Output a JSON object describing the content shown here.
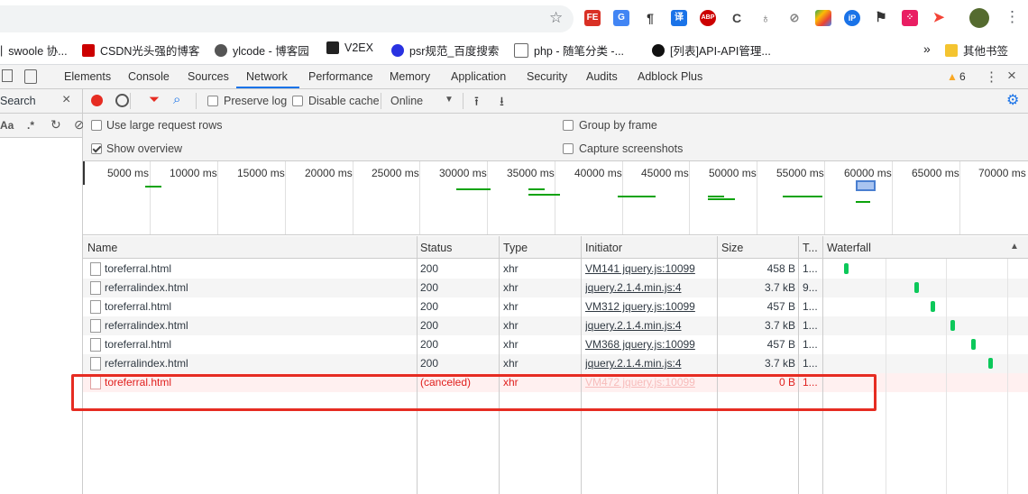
{
  "bookmarks": [
    {
      "label": "swoole 协...",
      "prefix": "|"
    },
    {
      "label": "CSDN光头强的博客"
    },
    {
      "label": "ylcode - 博客园"
    },
    {
      "label": "V2EX"
    },
    {
      "label": "psr规范_百度搜索"
    },
    {
      "label": "php - 随笔分类 -..."
    },
    {
      "label": "[列表]API-API管理..."
    },
    {
      "label": "»"
    },
    {
      "label": "其他书签"
    }
  ],
  "extensions": {
    "fe": "FE",
    "yi": "译",
    "abp": "ABP",
    "ip": "iP",
    "ci": "C"
  },
  "devtools": {
    "tabs": [
      "Elements",
      "Console",
      "Sources",
      "Network",
      "Performance",
      "Memory",
      "Application",
      "Security",
      "Audits",
      "Adblock Plus"
    ],
    "active_tab": "Network",
    "warning_count": "6",
    "close": "×",
    "more": "⋮"
  },
  "search": {
    "title": "Search",
    "close": "×",
    "aa": "Aa",
    "regex": ".*"
  },
  "network_toolbar": {
    "preserve_log": "Preserve log",
    "disable_cache": "Disable cache",
    "throttle": "Online"
  },
  "settings": {
    "large_rows": "Use large request rows",
    "show_overview": "Show overview",
    "group_by_frame": "Group by frame",
    "capture_screenshots": "Capture screenshots"
  },
  "overview": {
    "ticks": [
      "5000 ms",
      "10000 ms",
      "15000 ms",
      "20000 ms",
      "25000 ms",
      "30000 ms",
      "35000 ms",
      "40000 ms",
      "45000 ms",
      "50000 ms",
      "55000 ms",
      "60000 ms",
      "65000 ms",
      "70000 ms"
    ]
  },
  "columns": {
    "name": "Name",
    "status": "Status",
    "type": "Type",
    "initiator": "Initiator",
    "size": "Size",
    "time": "T...",
    "waterfall": "Waterfall"
  },
  "rows": [
    {
      "name": "toreferral.html",
      "status": "200",
      "type": "xhr",
      "initiator": "VM141 jquery.js:10099",
      "size": "458 B",
      "time": "1..."
    },
    {
      "name": "referralindex.html",
      "status": "200",
      "type": "xhr",
      "initiator": "jquery.2.1.4.min.js:4",
      "size": "3.7 kB",
      "time": "9..."
    },
    {
      "name": "toreferral.html",
      "status": "200",
      "type": "xhr",
      "initiator": "VM312 jquery.js:10099",
      "size": "457 B",
      "time": "1..."
    },
    {
      "name": "referralindex.html",
      "status": "200",
      "type": "xhr",
      "initiator": "jquery.2.1.4.min.js:4",
      "size": "3.7 kB",
      "time": "1..."
    },
    {
      "name": "toreferral.html",
      "status": "200",
      "type": "xhr",
      "initiator": "VM368 jquery.js:10099",
      "size": "457 B",
      "time": "1..."
    },
    {
      "name": "referralindex.html",
      "status": "200",
      "type": "xhr",
      "initiator": "jquery.2.1.4.min.js:4",
      "size": "3.7 kB",
      "time": "1..."
    },
    {
      "name": "toreferral.html",
      "status": "(canceled)",
      "type": "xhr",
      "initiator": "VM472 jquery.js:10099",
      "size": "0 B",
      "time": "1..."
    }
  ],
  "colors": {
    "accent": "#1a73e8",
    "error": "#e0201e",
    "highlight": "#e62c22",
    "waterfall": "#0cc85a"
  }
}
